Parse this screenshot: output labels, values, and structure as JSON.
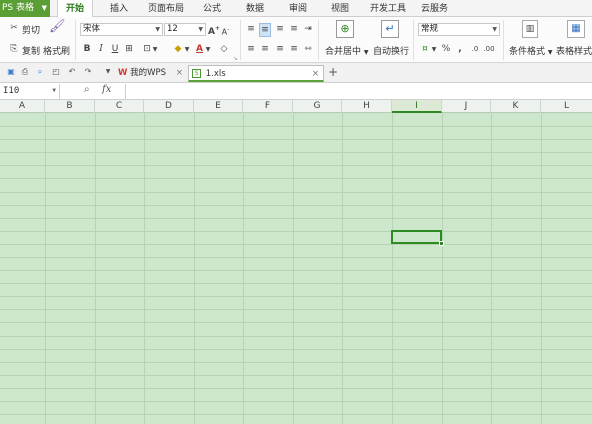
{
  "menubar": {
    "app_label": "PS 表格",
    "tabs": [
      {
        "label": "开始",
        "active": true
      },
      {
        "label": "插入"
      },
      {
        "label": "页面布局"
      },
      {
        "label": "公式"
      },
      {
        "label": "数据"
      },
      {
        "label": "审阅"
      },
      {
        "label": "视图"
      },
      {
        "label": "开发工具"
      },
      {
        "label": "云服务"
      }
    ]
  },
  "ribbon": {
    "cut_label": "剪切",
    "copy_label": "复制",
    "format_painter_label": "格式刷",
    "font_name": "宋体",
    "font_size": "12",
    "bold": "B",
    "italic": "I",
    "underline": "U",
    "merge_center_label": "合并居中",
    "wrap_text_label": "自动换行",
    "number_format": "常规",
    "percent": "%",
    "comma": ",",
    "conditional_format_label": "条件格式",
    "table_style_label": "表格样式"
  },
  "quickbar": {
    "doc_tabs": [
      {
        "label": "我的WPS",
        "active": false
      },
      {
        "label": "1.xls",
        "active": true
      }
    ]
  },
  "formula_bar": {
    "name_box": "I10",
    "fx_label": "fx",
    "value": ""
  },
  "sheet": {
    "columns": [
      "A",
      "B",
      "C",
      "D",
      "E",
      "F",
      "G",
      "H",
      "I",
      "J",
      "K",
      "L"
    ],
    "active_column": "I",
    "active_cell": "I10"
  },
  "colors": {
    "accent": "#5a9e35",
    "grid_background": "#cde7cc",
    "selection": "#2e8b22"
  }
}
